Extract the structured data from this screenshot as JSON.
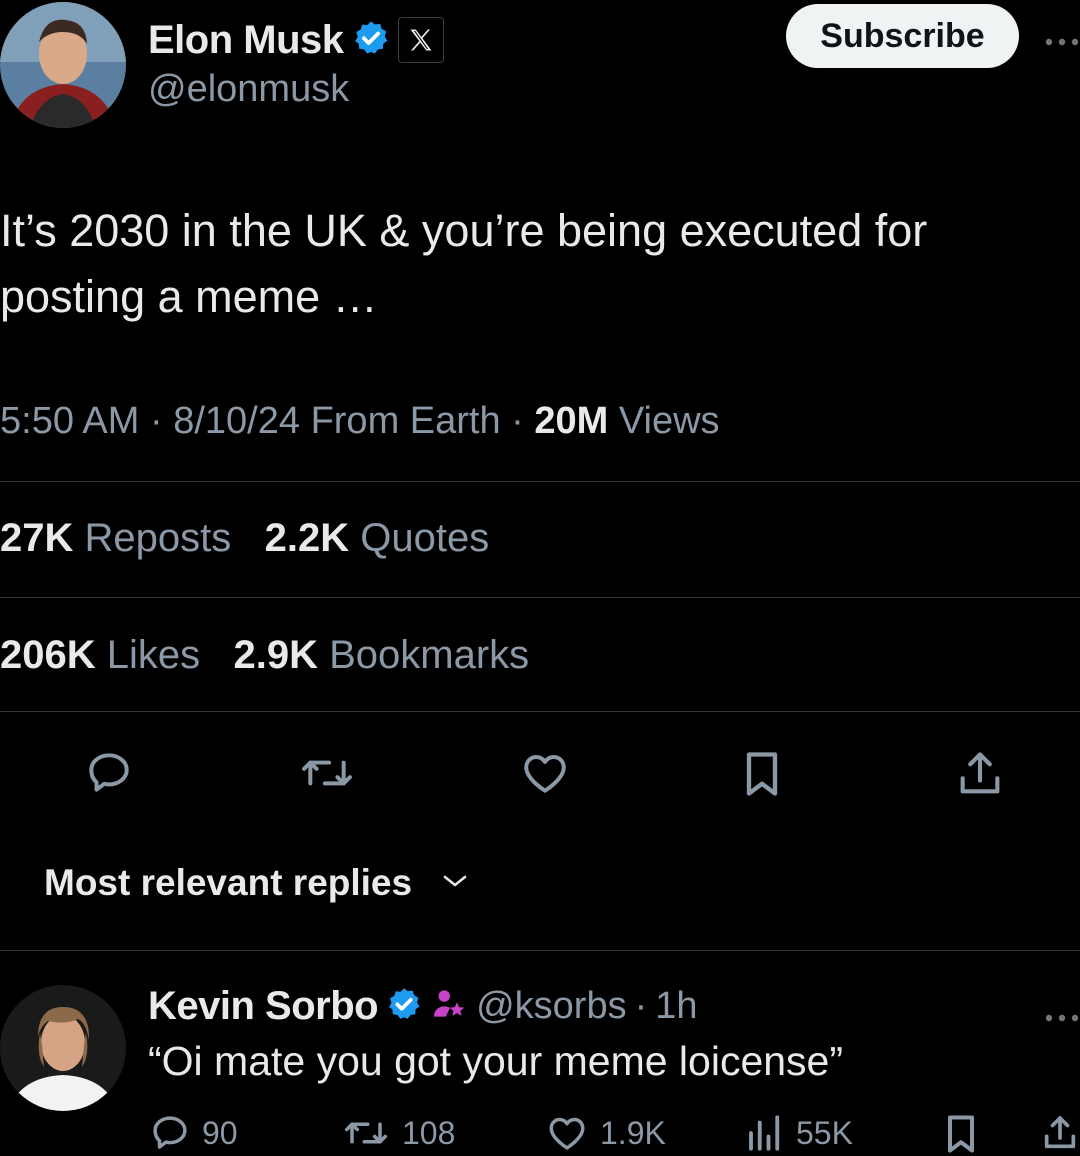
{
  "post": {
    "author": {
      "name": "Elon Musk",
      "handle": "@elonmusk",
      "verified": true,
      "affiliate_badge": "X"
    },
    "subscribe_label": "Subscribe",
    "more_icon": "more-icon",
    "text": "It’s 2030 in the UK & you’re being executed for posting a meme …",
    "time": "5:50 AM",
    "date": "8/10/24",
    "source": "From Earth",
    "views_count": "20M",
    "views_label": "Views",
    "separator": "·",
    "stats": {
      "reposts_count": "27K",
      "reposts_label": "Reposts",
      "quotes_count": "2.2K",
      "quotes_label": "Quotes",
      "likes_count": "206K",
      "likes_label": "Likes",
      "bookmarks_count": "2.9K",
      "bookmarks_label": "Bookmarks"
    }
  },
  "actions": [
    "reply-icon",
    "repost-icon",
    "like-icon",
    "bookmark-icon",
    "share-icon"
  ],
  "replies_sort": {
    "label": "Most relevant replies"
  },
  "reply": {
    "name": "Kevin Sorbo",
    "handle": "@ksorbs",
    "time": "1h",
    "text": "“Oi mate you got your meme loicense”",
    "replies": "90",
    "reposts": "108",
    "likes": "1.9K",
    "views": "55K"
  },
  "colors": {
    "background": "#000000",
    "text": "#e7e9ea",
    "secondary": "#8b98a5",
    "verified": "#1d9bf0",
    "divider": "#2f3336"
  }
}
